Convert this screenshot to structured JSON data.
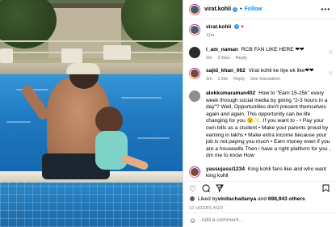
{
  "post": {
    "author": "virat.kohli",
    "follow_label": "Follow",
    "dot": "•",
    "more_label": "•••",
    "caption_text": "♥",
    "caption_time": "11m",
    "image_description": "pool"
  },
  "comments": [
    {
      "user": "i_am_naman",
      "text": "RCB FAN LIKE HERE ❤❤",
      "time": "3m",
      "likes": "2 likes",
      "reply": "Reply"
    },
    {
      "user": "sajid_khan_062",
      "text": "Virat kohli ke liye ek like❤❤",
      "time": "3m",
      "likes": "1 like",
      "reply": "Reply",
      "extra": "See translation"
    },
    {
      "user": "alokkumaraman402",
      "text": "How to \"Earn 15-25k\" every week through social media by giving \"2-3 hours in a day\"? Well, Opportunities don't present themselves again and again. This opportunity can be life changing for you 😉✨. If you want to - • Pay your own bills as a student • Make your parents proud by earning in lakhs • Make extra income because your job is not paying you much • Earn money even if you are a housewife Then i have a right platform for you , dm me to know How",
      "time": "",
      "likes": "",
      "reply": ""
    },
    {
      "user": "yassujassi1234",
      "text": "King kohli fans like and who want king kohli",
      "time": "",
      "likes": "",
      "reply": ""
    }
  ],
  "actions": {
    "like_icon": "heart-outline-icon",
    "comment_icon": "comment-icon",
    "share_icon": "share-icon",
    "save_icon": "bookmark-icon"
  },
  "likes_line": {
    "prefix": "Liked by ",
    "user": "vinitachaitanya",
    "middle": " and ",
    "others": "698,943 others"
  },
  "date": "12 HOURS AGO",
  "add_comment": {
    "placeholder": "Add a comment..."
  }
}
